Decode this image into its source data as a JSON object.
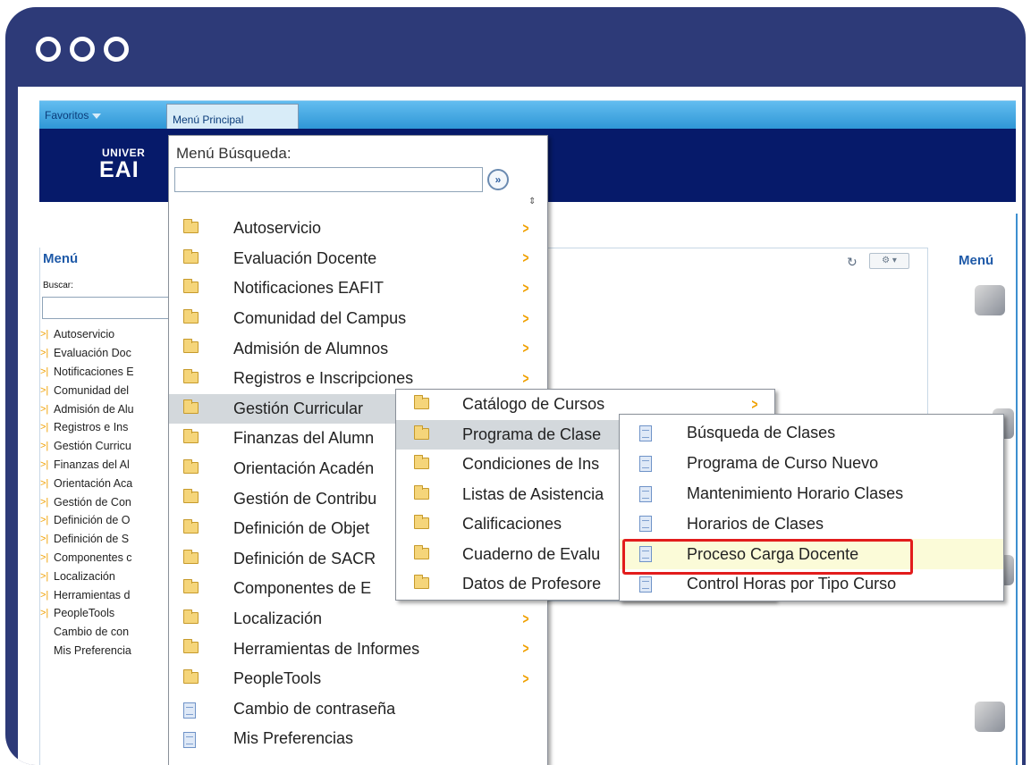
{
  "window": {
    "controls": [
      "circle",
      "circle",
      "circle"
    ]
  },
  "navbar": {
    "favorites_label": "Favoritos",
    "main_menu_label": "Menú Principal"
  },
  "banner": {
    "logo_line1": "UNIVER",
    "logo_line2": "EAI"
  },
  "left_panel": {
    "title": "Menú",
    "search_label": "Buscar:",
    "items": [
      {
        "label": "Autoservicio",
        "folder": true
      },
      {
        "label": "Evaluación Doc",
        "folder": true
      },
      {
        "label": "Notificaciones E",
        "folder": true
      },
      {
        "label": "Comunidad del",
        "folder": true
      },
      {
        "label": "Admisión de Alu",
        "folder": true
      },
      {
        "label": "Registros e Ins",
        "folder": true
      },
      {
        "label": "Gestión Curricu",
        "folder": true
      },
      {
        "label": "Finanzas del Al",
        "folder": true
      },
      {
        "label": "Orientación Aca",
        "folder": true
      },
      {
        "label": "Gestión de Con",
        "folder": true
      },
      {
        "label": "Definición de O",
        "folder": true
      },
      {
        "label": "Definición de S",
        "folder": true
      },
      {
        "label": "Componentes c",
        "folder": true
      },
      {
        "label": "Localización",
        "folder": true
      },
      {
        "label": "Herramientas d",
        "folder": true
      },
      {
        "label": "PeopleTools",
        "folder": true
      },
      {
        "label": "Cambio de con",
        "folder": false
      },
      {
        "label": "Mis Preferencia",
        "folder": false
      }
    ]
  },
  "right_panel": {
    "title": "Menú"
  },
  "main_menu": {
    "search_label": "Menú Búsqueda:",
    "search_value": "",
    "go_symbol": "»",
    "sort_symbol": "⇕",
    "items": [
      {
        "label": "Autoservicio",
        "icon": "folder-icon",
        "submenu": true
      },
      {
        "label": "Evaluación Docente",
        "icon": "folder-icon",
        "submenu": true
      },
      {
        "label": "Notificaciones EAFIT",
        "icon": "folder-icon",
        "submenu": true
      },
      {
        "label": "Comunidad del Campus",
        "icon": "folder-icon",
        "submenu": true
      },
      {
        "label": "Admisión de Alumnos",
        "icon": "folder-icon",
        "submenu": true
      },
      {
        "label": "Registros e Inscripciones",
        "icon": "folder-icon",
        "submenu": true
      },
      {
        "label": "Gestión Curricular",
        "icon": "folder-icon",
        "submenu": true,
        "highlighted": true
      },
      {
        "label": "Finanzas del Alumn",
        "icon": "folder-icon",
        "submenu": false
      },
      {
        "label": "Orientación Acadén",
        "icon": "folder-icon",
        "submenu": false
      },
      {
        "label": "Gestión de Contribu",
        "icon": "folder-icon",
        "submenu": false
      },
      {
        "label": "Definición de Objet",
        "icon": "folder-icon",
        "submenu": false
      },
      {
        "label": "Definición de SACR",
        "icon": "folder-icon",
        "submenu": false
      },
      {
        "label": "Componentes de E",
        "icon": "folder-icon",
        "submenu": false
      },
      {
        "label": "Localización",
        "icon": "folder-icon",
        "submenu": true
      },
      {
        "label": "Herramientas de Informes",
        "icon": "folder-icon",
        "submenu": true
      },
      {
        "label": "PeopleTools",
        "icon": "folder-icon",
        "submenu": true
      },
      {
        "label": "Cambio de contraseña",
        "icon": "document-icon",
        "submenu": false
      },
      {
        "label": "Mis Preferencias",
        "icon": "document-icon",
        "submenu": false
      }
    ]
  },
  "submenu_curricular": {
    "items": [
      {
        "label": "Catálogo de Cursos",
        "icon": "folder-icon",
        "submenu": true
      },
      {
        "label": "Programa de Clase",
        "icon": "folder-icon",
        "submenu": false,
        "highlighted": true
      },
      {
        "label": "Condiciones de Ins",
        "icon": "folder-icon",
        "submenu": false
      },
      {
        "label": "Listas de Asistencia",
        "icon": "folder-icon",
        "submenu": false
      },
      {
        "label": "Calificaciones",
        "icon": "folder-icon",
        "submenu": false
      },
      {
        "label": "Cuaderno de Evalu",
        "icon": "folder-icon",
        "submenu": false
      },
      {
        "label": "Datos de Profesore",
        "icon": "folder-icon",
        "submenu": false
      }
    ]
  },
  "submenu_programa": {
    "items": [
      {
        "label": "Búsqueda de Clases",
        "icon": "document-icon"
      },
      {
        "label": "Programa de Curso Nuevo",
        "icon": "document-icon"
      },
      {
        "label": "Mantenimiento Horario Clases",
        "icon": "document-icon"
      },
      {
        "label": "Horarios de Clases",
        "icon": "document-icon"
      },
      {
        "label": "Proceso Carga Docente",
        "icon": "document-icon",
        "selected": true
      },
      {
        "label": "Control Horas por Tipo Curso",
        "icon": "document-icon"
      }
    ]
  },
  "colors": {
    "frame": "#2d3a78",
    "navbar": "#3aa0e0",
    "banner": "#061a6a",
    "arrow": "#f0a000",
    "selection": "#e21c1c"
  }
}
